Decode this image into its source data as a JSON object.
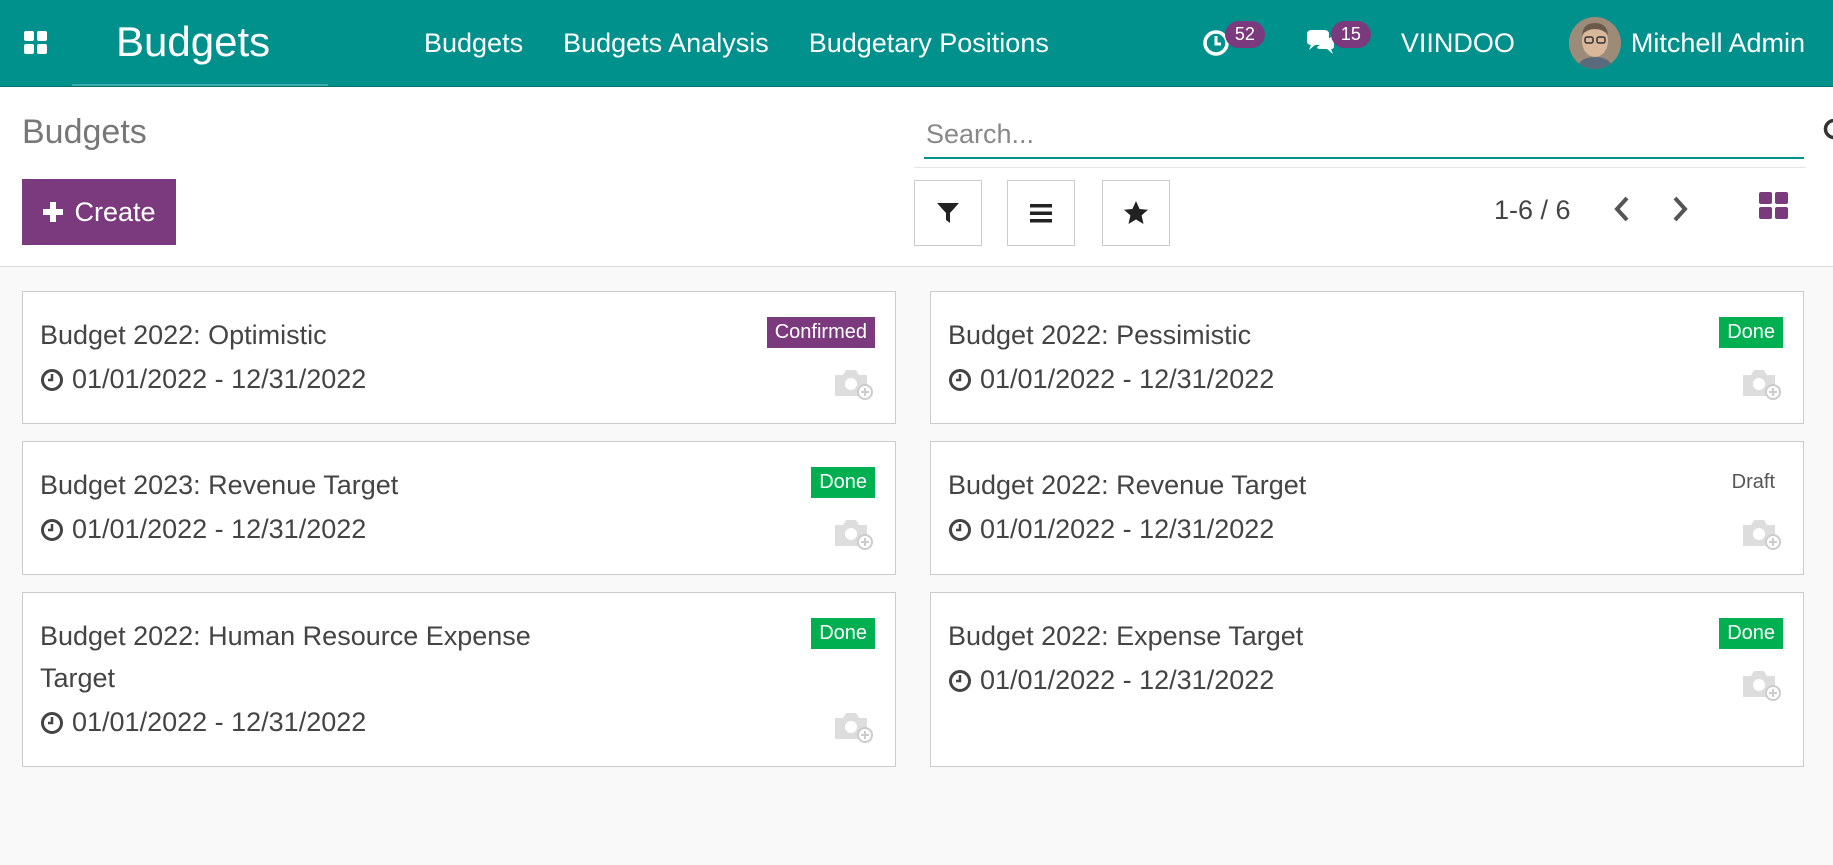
{
  "navbar": {
    "app_title": "Budgets",
    "menu": [
      "Budgets",
      "Budgets Analysis",
      "Budgetary Positions"
    ],
    "activity_count": "52",
    "messages_count": "15",
    "company": "VIINDOO",
    "user_name": "Mitchell Admin"
  },
  "control_panel": {
    "breadcrumb": "Budgets",
    "create_label": "Create",
    "search_placeholder": "Search...",
    "pager": "1-6 / 6"
  },
  "budgets": [
    {
      "name": "Budget 2022: Optimistic",
      "dates": "01/01/2022 - 12/31/2022",
      "status": "Confirmed"
    },
    {
      "name": "Budget 2022: Pessimistic",
      "dates": "01/01/2022 - 12/31/2022",
      "status": "Done"
    },
    {
      "name": "Budget 2023: Revenue Target",
      "dates": "01/01/2022 - 12/31/2022",
      "status": "Done"
    },
    {
      "name": "Budget 2022: Revenue Target",
      "dates": "01/01/2022 - 12/31/2022",
      "status": "Draft"
    },
    {
      "name": "Budget 2022: Human Resource Expense Target",
      "dates": "01/01/2022 - 12/31/2022",
      "status": "Done"
    },
    {
      "name": "Budget 2022: Expense Target",
      "dates": "01/01/2022 - 12/31/2022",
      "status": "Done"
    }
  ],
  "colors": {
    "navbar": "#00918d",
    "primary": "#7c3a7e",
    "done": "#00b050"
  },
  "icons": {
    "apps": "grid-icon",
    "activity": "clock-icon",
    "messages": "chat-icon",
    "search": "search-icon",
    "filter": "filter-icon",
    "group_by": "list-icon",
    "favorites": "star-icon",
    "prev": "chevron-left-icon",
    "next": "chevron-right-icon",
    "kanban": "kanban-grid-icon",
    "date": "clock-icon",
    "image": "camera-add-icon"
  }
}
